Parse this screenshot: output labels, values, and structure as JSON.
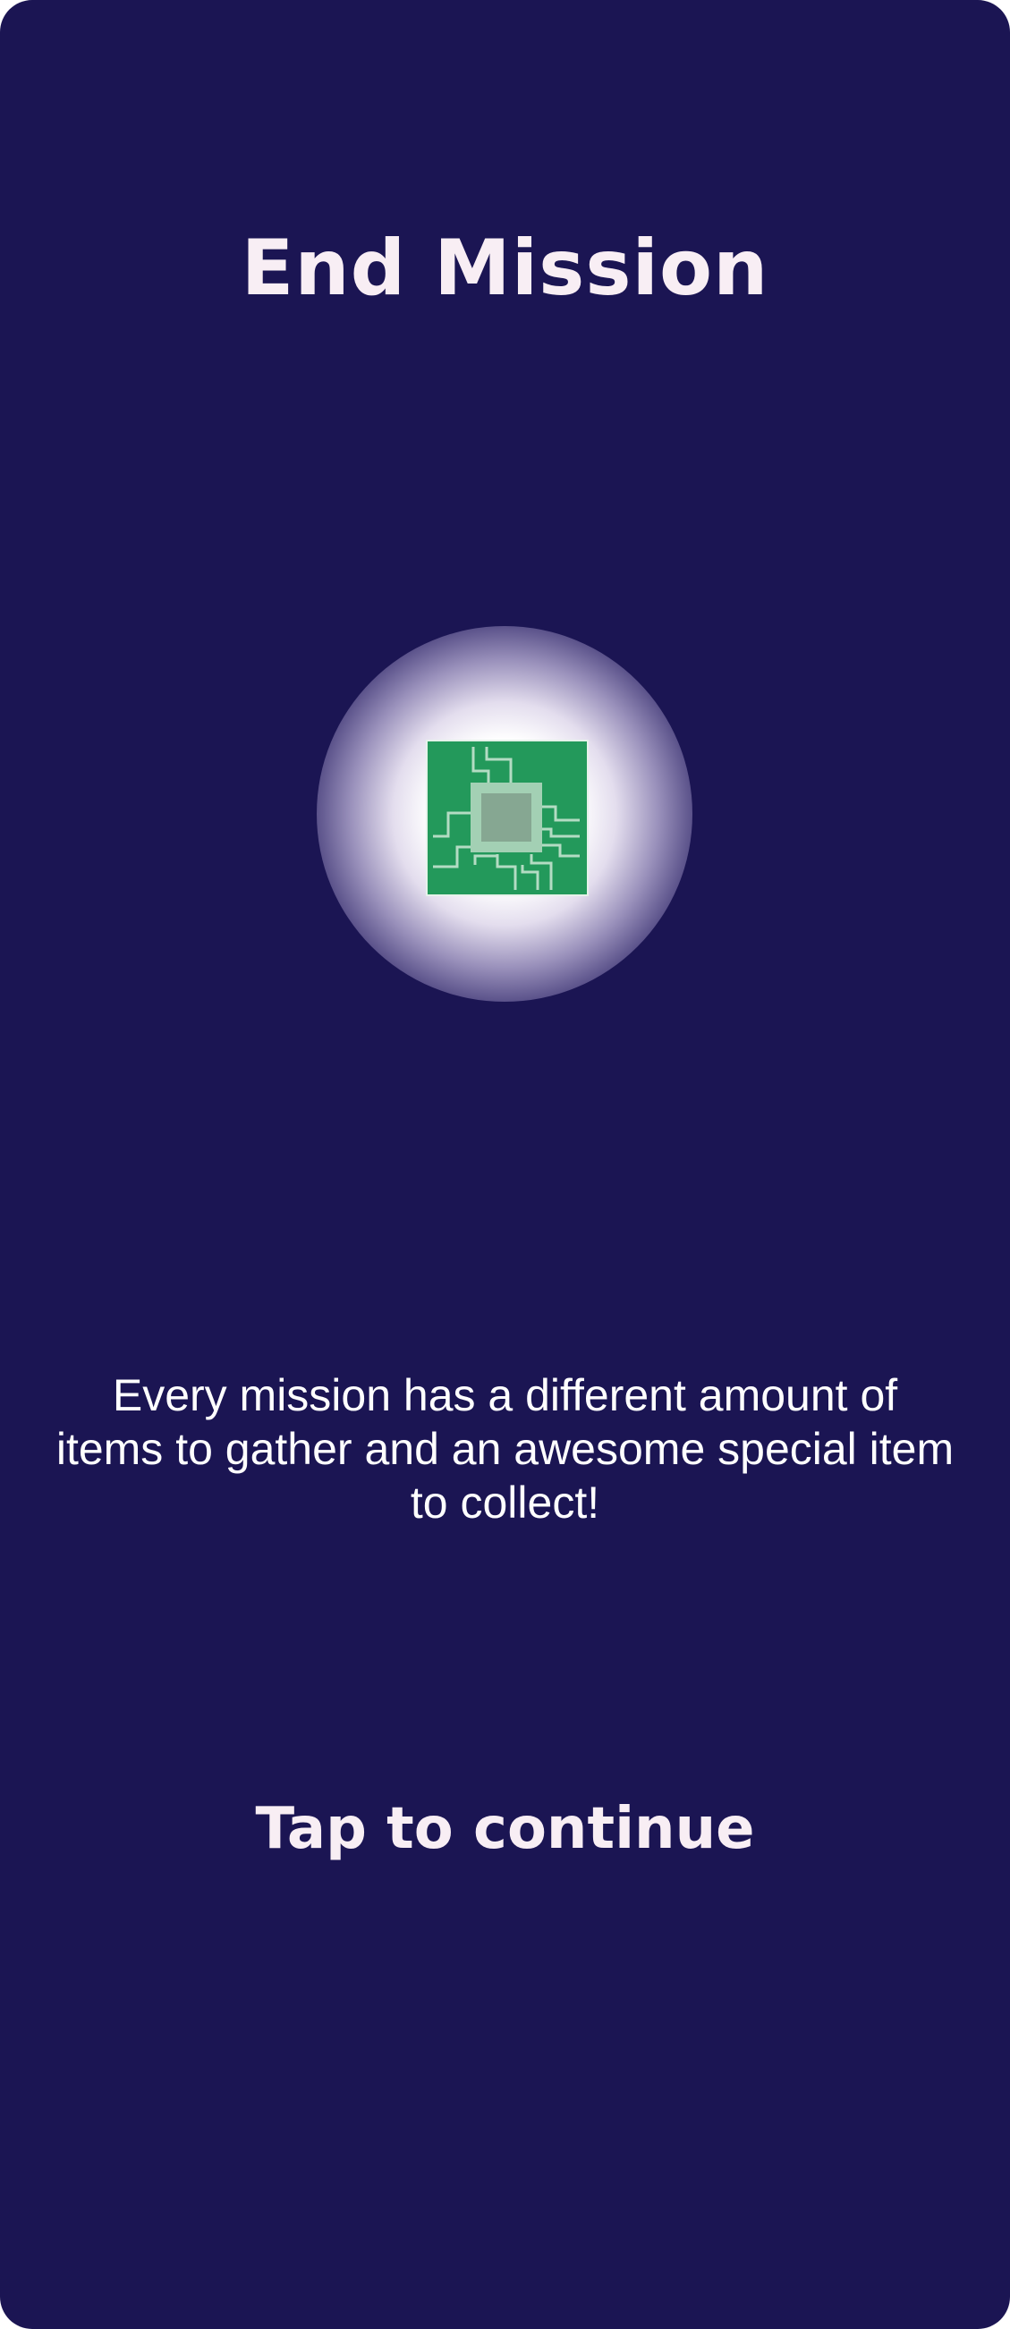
{
  "screen": {
    "title": "End Mission",
    "description": "Every mission has a different amount of items to gather and an awesome special item to collect!",
    "continue_label": "Tap to continue"
  },
  "reward": {
    "icon": "circuit-chip-icon"
  },
  "colors": {
    "background": "#1b1553",
    "title_text": "#f8eef4",
    "chip_board": "#23995b",
    "chip_trace": "#b3dcc3",
    "chip_core": "#86a792"
  }
}
